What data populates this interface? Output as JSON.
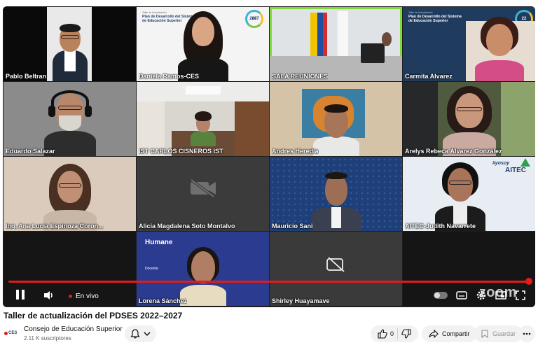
{
  "participants": [
    {
      "name": "Pablo Beltran"
    },
    {
      "name": "Daniela Ramos-CES"
    },
    {
      "name": "SALA REUNIONES"
    },
    {
      "name": "Carmita Alvarez"
    },
    {
      "name": "Eduardo Salazar"
    },
    {
      "name": "IST CARLOS CISNEROS IST"
    },
    {
      "name": "Andres Heredia"
    },
    {
      "name": "Arelys Rebeca Álvarez González"
    },
    {
      "name": "Ing. Ana Lucia Espinoza Coron..."
    },
    {
      "name": "Alicia Magdalena Soto Montalvo"
    },
    {
      "name": "Mauricio Sani"
    },
    {
      "name": "AITEC-Judith Navarrete"
    },
    {
      "name": ""
    },
    {
      "name": "Lorena Sánchez"
    },
    {
      "name": "Shirley Huayamave"
    },
    {
      "name": ""
    }
  ],
  "slides": {
    "plan_small": "Taller de Actualización",
    "plan_title_1": "Plan de Desarrollo del Sistema",
    "plan_title_2": "de Educación Superior",
    "logo_text_1": "20",
    "logo_text_2": "2027",
    "logo_text_right": "22",
    "humane_brand": "Humane",
    "humane_role": "Docente",
    "aitec_tag": "#yosoy",
    "aitec_name": "AITEC"
  },
  "player": {
    "live_label": "En vivo",
    "watermark": "zoom",
    "progress": 1.0
  },
  "video": {
    "title": "Taller de actualización del PDSES 2022–2027",
    "channel_logo": "CES",
    "channel_name": "Consejo de Educación Superior",
    "subscribers": "2.11 K suscriptores",
    "like_count": "0",
    "share_label": "Compartir",
    "save_label": "Guardar"
  },
  "colors": {
    "active_speaker": "#7ddb3a",
    "progress": "#e31b1b",
    "brand_blue": "#22406e"
  }
}
